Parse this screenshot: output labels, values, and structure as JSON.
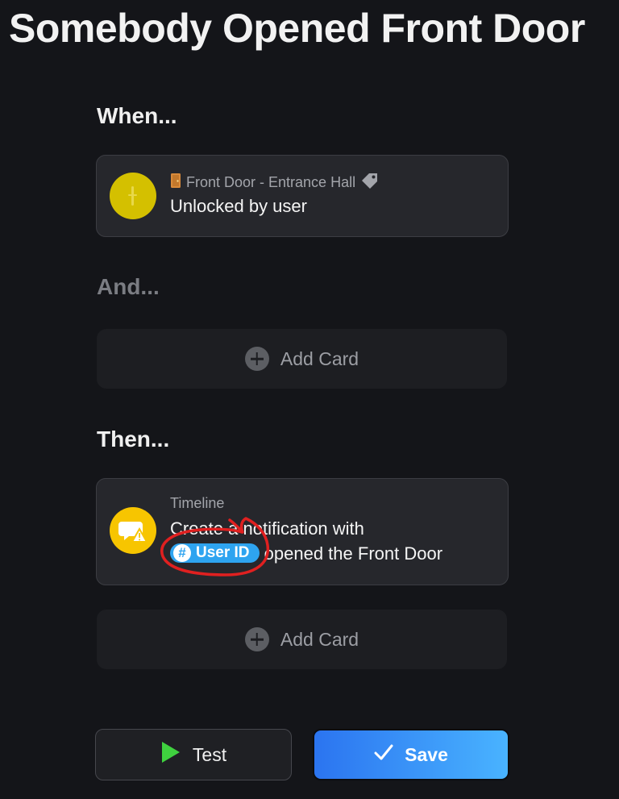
{
  "flow": {
    "title": "Somebody Opened Front Door"
  },
  "when": {
    "label": "When...",
    "card": {
      "device": "Front Door - Entrance Hall",
      "text": "Unlocked by user",
      "color": "#d4c000"
    }
  },
  "and": {
    "label": "And...",
    "add_card_label": "Add Card"
  },
  "then": {
    "label": "Then...",
    "card": {
      "app": "Timeline",
      "text_line1": "Create a notification with",
      "token_label": "User ID",
      "text_line2_suffix": "opened the Front Door",
      "color": "#f7c500"
    },
    "add_card_label": "Add Card"
  },
  "actions": {
    "test_label": "Test",
    "save_label": "Save"
  },
  "icons": {
    "when_card": "lock-icon",
    "device": "door-icon",
    "tag": "tag-icon",
    "then_card": "notification-icon",
    "token": "hash-icon",
    "add": "plus-circle-icon",
    "test": "play-icon",
    "save": "checkmark-icon"
  }
}
